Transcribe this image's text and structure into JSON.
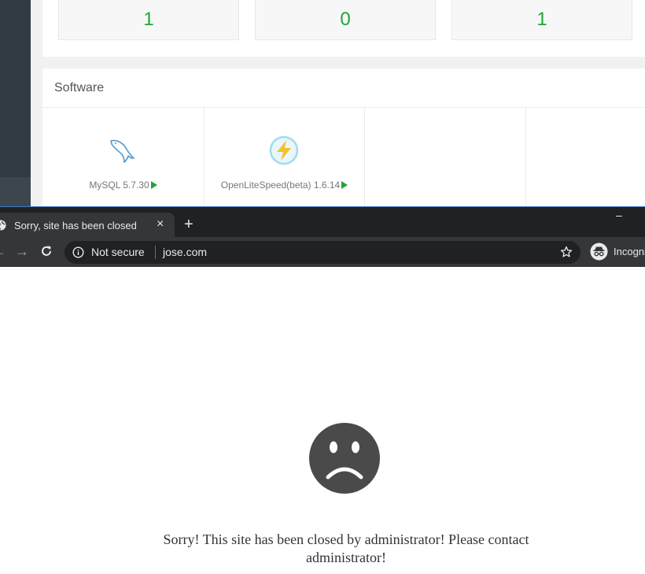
{
  "panel": {
    "stats": [
      "1",
      "0",
      "1"
    ],
    "software_title": "Software",
    "software": [
      {
        "name": "MySQL 5.7.30",
        "icon": "mysql-dolphin-icon"
      },
      {
        "name": "OpenLiteSpeed(beta) 1.6.14",
        "icon": "openlitespeed-icon"
      }
    ],
    "accent_color": "#20a53a"
  },
  "browser": {
    "tab_title": "Sorry, site has been closed",
    "tab_close": "×",
    "new_tab": "+",
    "minimize": "–",
    "back": "←",
    "forward": "→",
    "not_secure_label": "Not secure",
    "url": "jose.com",
    "incognito_label": "Incognito"
  },
  "page": {
    "message": "Sorry! This site has been closed by administrator! Please contact administrator!",
    "icon": "sad-face-icon"
  }
}
